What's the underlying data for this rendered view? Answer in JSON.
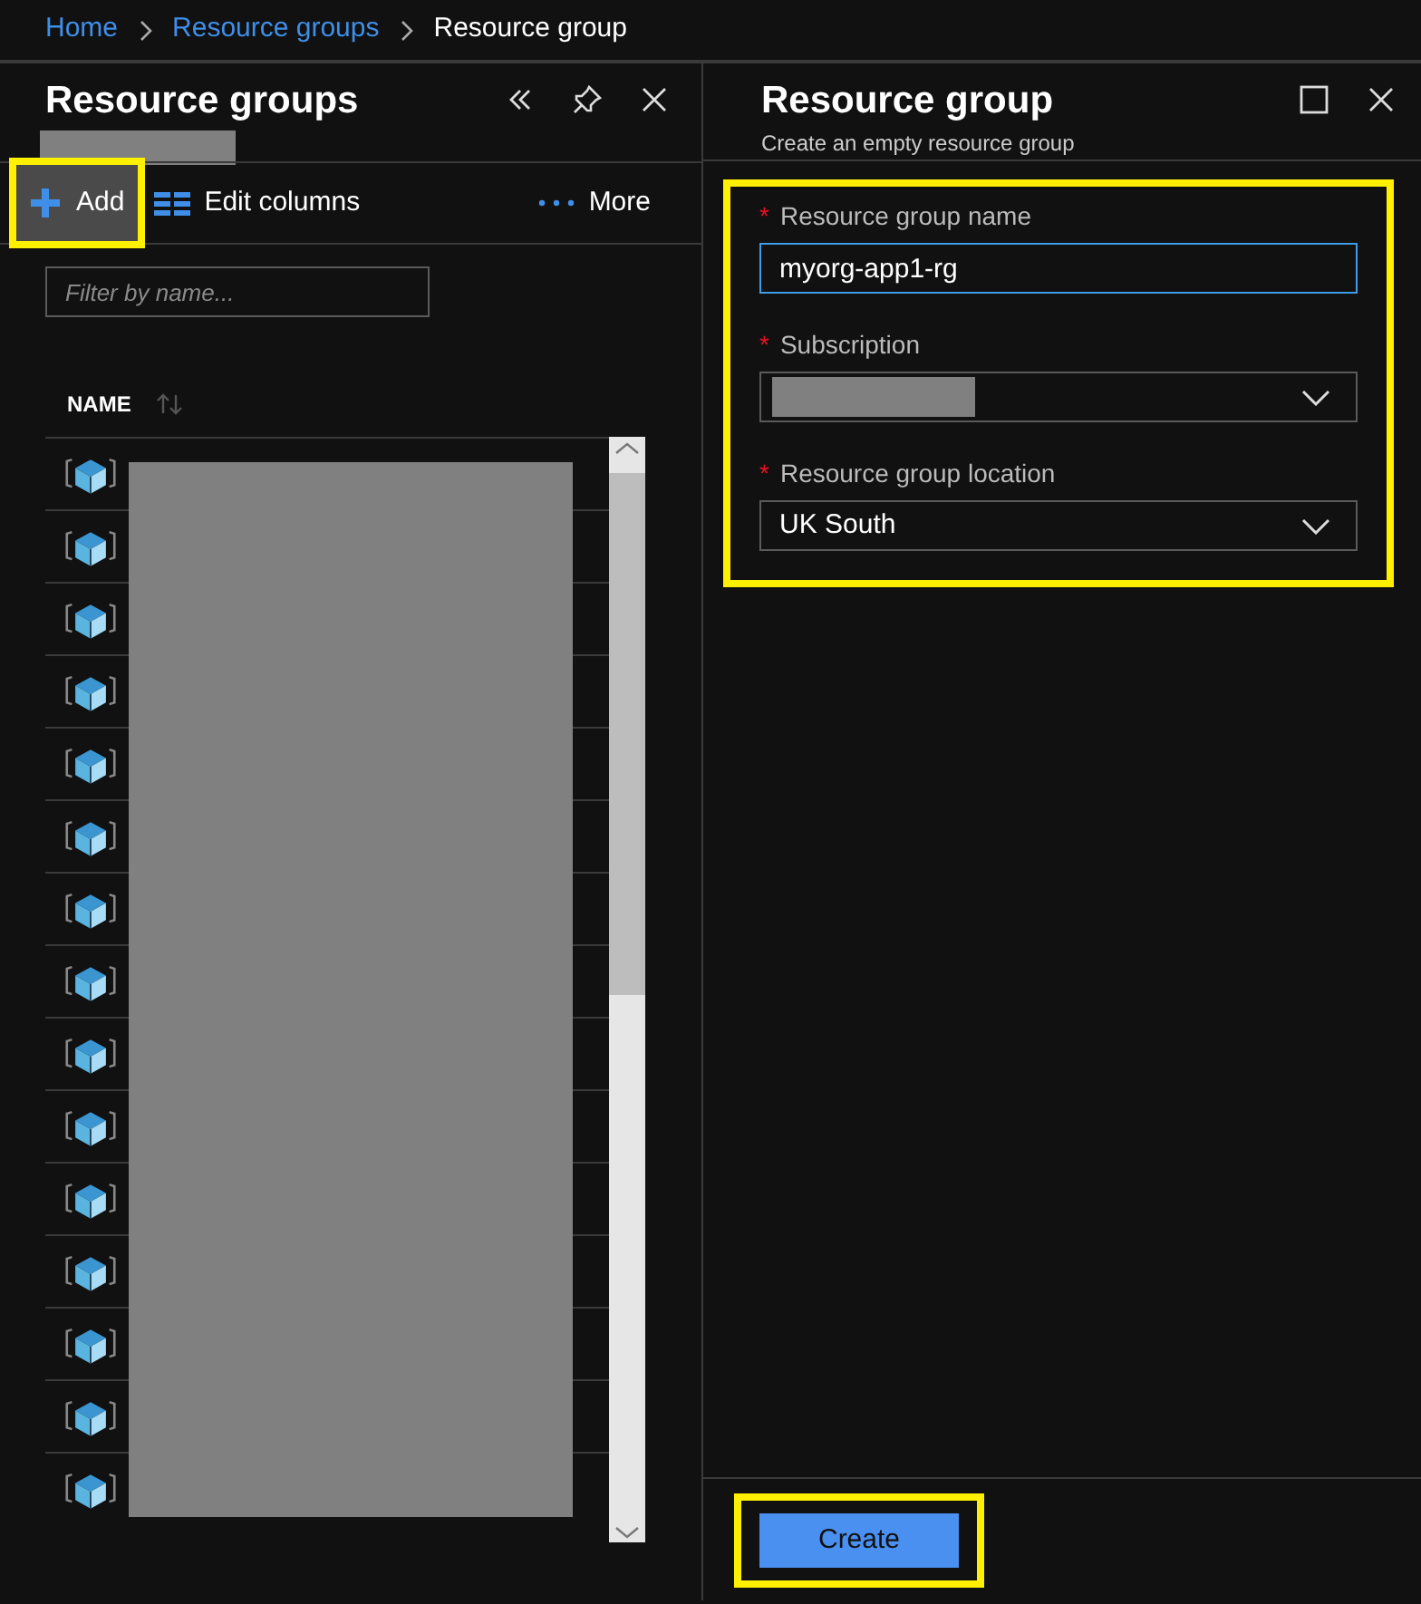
{
  "breadcrumb": [
    {
      "label": "Home",
      "link": true
    },
    {
      "label": "Resource groups",
      "link": true
    },
    {
      "label": "Resource group",
      "link": false
    }
  ],
  "left_panel": {
    "title": "Resource groups",
    "subtitle_redacted": true,
    "toolbar": [
      {
        "kind": "add",
        "label": "Add",
        "highlighted": true
      },
      {
        "kind": "columns",
        "label": "Edit columns",
        "highlighted": false
      },
      {
        "kind": "more",
        "label": "More",
        "highlighted": false
      }
    ],
    "filter": {
      "placeholder": "Filter by name..."
    },
    "column": "NAME",
    "rows": [
      {
        "name_redacted": true
      },
      {
        "name_redacted": true
      },
      {
        "name_redacted": true
      },
      {
        "name_redacted": true
      },
      {
        "name_redacted": true
      },
      {
        "name_redacted": true
      },
      {
        "name_redacted": true
      },
      {
        "name_redacted": true
      },
      {
        "name_redacted": true
      },
      {
        "name_redacted": true
      },
      {
        "name_redacted": true
      },
      {
        "name_redacted": true
      },
      {
        "name_redacted": true
      },
      {
        "name_redacted": true
      },
      {
        "name_redacted": true
      }
    ]
  },
  "right_panel": {
    "title": "Resource group",
    "subtitle": "Create an empty resource group",
    "form_highlighted": true,
    "fields": [
      {
        "kind": "text",
        "label": "Resource group name",
        "required_mark": "*",
        "value": "myorg-app1-rg",
        "focused": true
      },
      {
        "kind": "select",
        "label": "Subscription",
        "required_mark": "*",
        "value_redacted": true
      },
      {
        "kind": "select",
        "label": "Resource group location",
        "required_mark": "*",
        "value": "UK South"
      }
    ],
    "create_button": {
      "label": "Create",
      "highlighted": true
    }
  }
}
